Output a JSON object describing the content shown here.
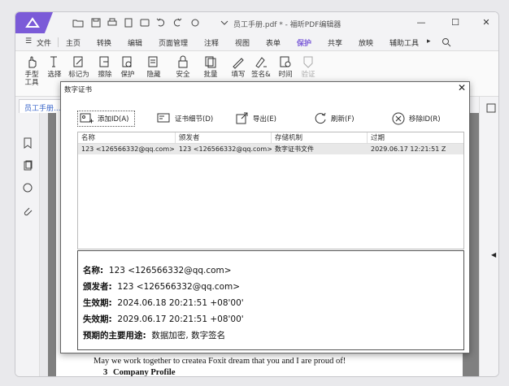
{
  "window": {
    "title": "员工手册.pdf * - 福昕PDF编辑器",
    "minimize": "—",
    "maximize": "☐",
    "close": "✕"
  },
  "menu": {
    "file": "文件",
    "tabs": [
      "主页",
      "转换",
      "编辑",
      "页面管理",
      "注释",
      "视图",
      "表单",
      "保护",
      "共享",
      "放映",
      "辅助工具"
    ],
    "active_tab": "保护"
  },
  "ribbon": {
    "buttons": [
      {
        "label1": "手型",
        "label2": "工具",
        "icon": "hand-icon"
      },
      {
        "label1": "选择",
        "label2": "",
        "icon": "select-icon"
      },
      {
        "label1": "标记为",
        "label2": "",
        "icon": "mark-icon"
      },
      {
        "label1": "擦除",
        "label2": "",
        "icon": "erase-icon"
      },
      {
        "label1": "保护",
        "label2": "",
        "icon": "protect-icon"
      },
      {
        "label1": "隐藏",
        "label2": "",
        "icon": "hide-icon"
      },
      {
        "label1": "安全",
        "label2": "",
        "icon": "security-icon"
      },
      {
        "label1": "批量",
        "label2": "",
        "icon": "batch-icon"
      },
      {
        "label1": "填写",
        "label2": "",
        "icon": "fill-icon"
      },
      {
        "label1": "签名&",
        "label2": "",
        "icon": "sign-icon"
      },
      {
        "label1": "时间",
        "label2": "",
        "icon": "time-icon"
      },
      {
        "label1": "验证",
        "label2": "",
        "icon": "verify-icon"
      }
    ]
  },
  "doc_tab": {
    "label": "员工手册..."
  },
  "document": {
    "line1": "May we work together to createa Foxit dream that you and I are proud of!",
    "heading_num": "3",
    "heading": "Company Profile"
  },
  "dialog": {
    "title": "数字证书",
    "close": "✕",
    "toolbar": {
      "add": "添加ID(A)",
      "details": "证书细节(D)",
      "export": "导出(E)",
      "refresh": "刷新(F)",
      "remove": "移除ID(R)"
    },
    "columns": [
      "名称",
      "颁发者",
      "存储机制",
      "过期"
    ],
    "rows": [
      {
        "name": "123 <126566332@qq.com>",
        "issuer": "123 <126566332@qq.com>",
        "storage": "数字证书文件",
        "expires": "2029.06.17 12:21:51 Z"
      }
    ],
    "detail": {
      "name_label": "名称:",
      "name_value": "123 <126566332@qq.com>",
      "issuer_label": "颁发者:",
      "issuer_value": "123 <126566332@qq.com>",
      "valid_from_label": "生效期:",
      "valid_from_value": "2024.06.18 20:21:51 +08'00'",
      "valid_to_label": "失效期:",
      "valid_to_value": "2029.06.17 20:21:51 +08'00'",
      "usage_label": "预期的主要用途:",
      "usage_value": "数据加密, 数字签名"
    }
  },
  "colors": {
    "accent": "#7b5bd8",
    "link": "#3a66c9"
  }
}
